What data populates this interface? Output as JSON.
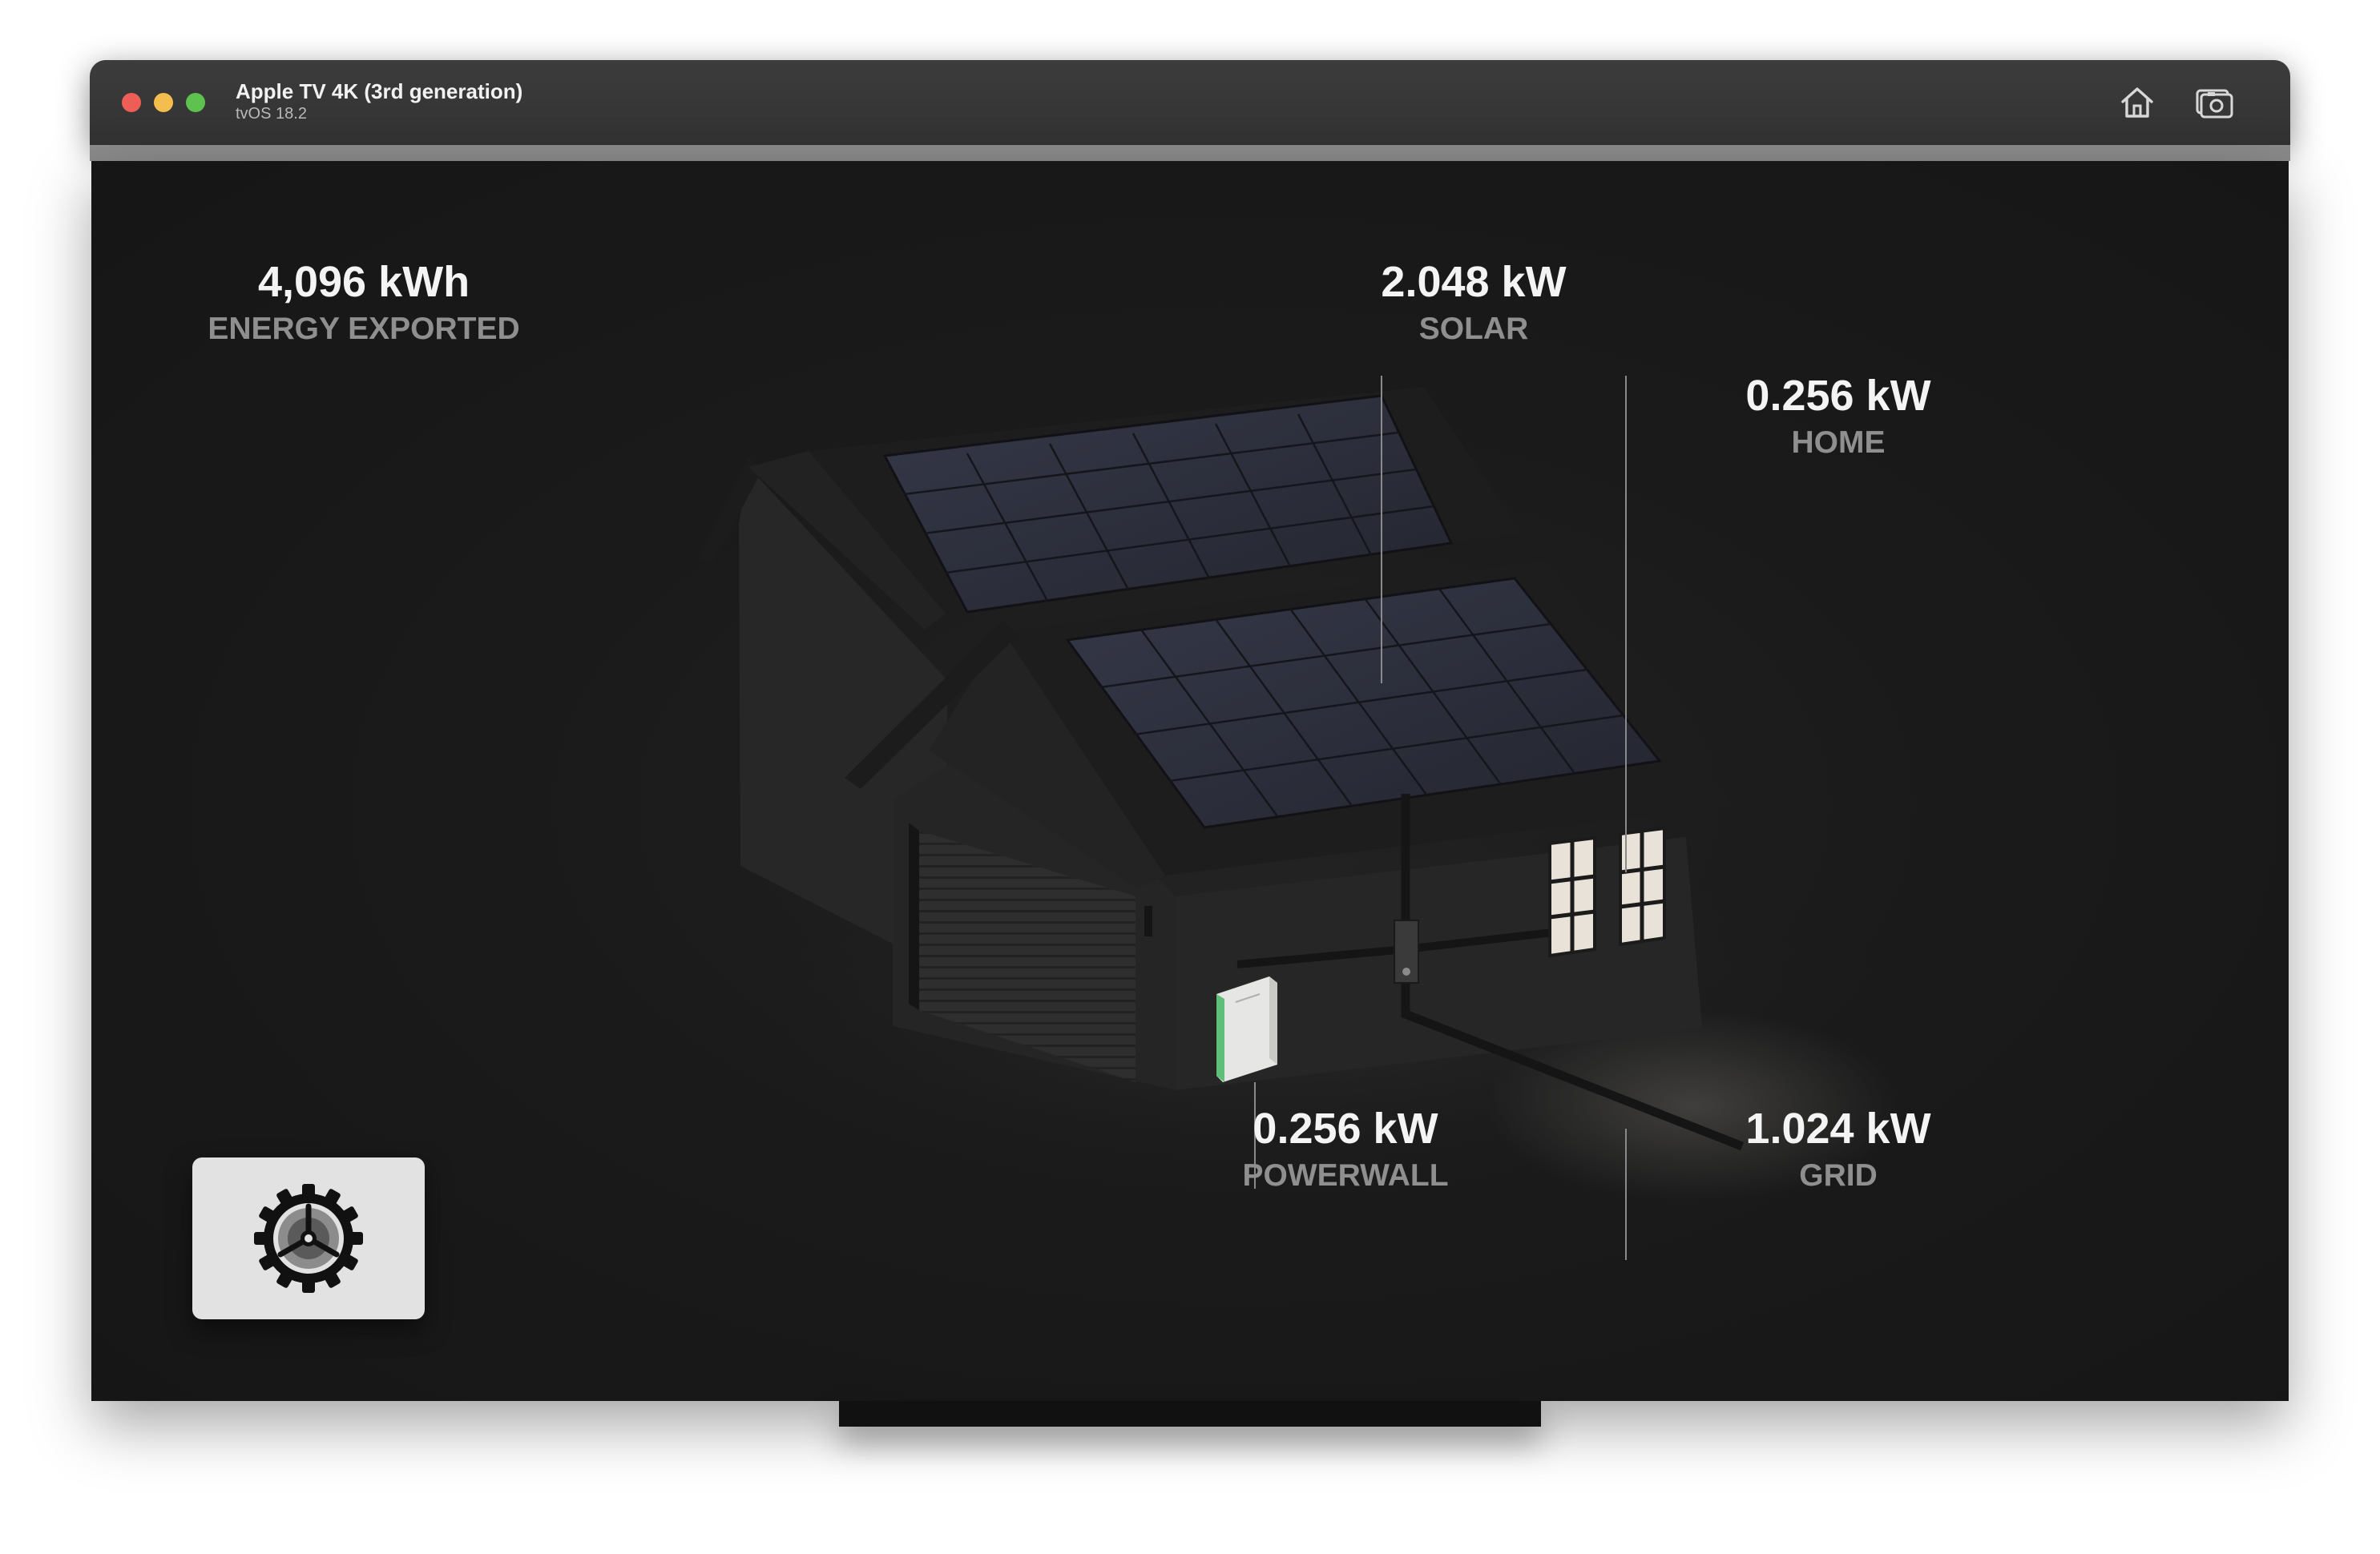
{
  "window": {
    "device_name": "Apple TV 4K (3rd generation)",
    "os_version": "tvOS 18.2",
    "traffic_lights": {
      "close_color": "#ed5f56",
      "minimize_color": "#f4be4f",
      "maximize_color": "#5ec24f"
    },
    "toolbar": {
      "home_icon": "house-icon",
      "screenshot_icon": "camera-screenshot-icon"
    }
  },
  "dashboard": {
    "energy_exported": {
      "value": "4,096 kWh",
      "label": "ENERGY EXPORTED"
    },
    "solar": {
      "value": "2.048 kW",
      "label": "SOLAR"
    },
    "home": {
      "value": "0.256 kW",
      "label": "HOME"
    },
    "powerwall": {
      "value": "0.256 kW",
      "label": "POWERWALL"
    },
    "grid": {
      "value": "1.024 kW",
      "label": "GRID"
    }
  },
  "settings": {
    "icon": "gear-icon"
  },
  "colors": {
    "screen_background": "#1a1a1a",
    "value_text": "#f4f4f4",
    "label_text": "#8f8f8f",
    "solar_panel": "#2a2d3b",
    "powerwall_accent": "#5fbf78",
    "window_glow": "#e8e2d8"
  }
}
